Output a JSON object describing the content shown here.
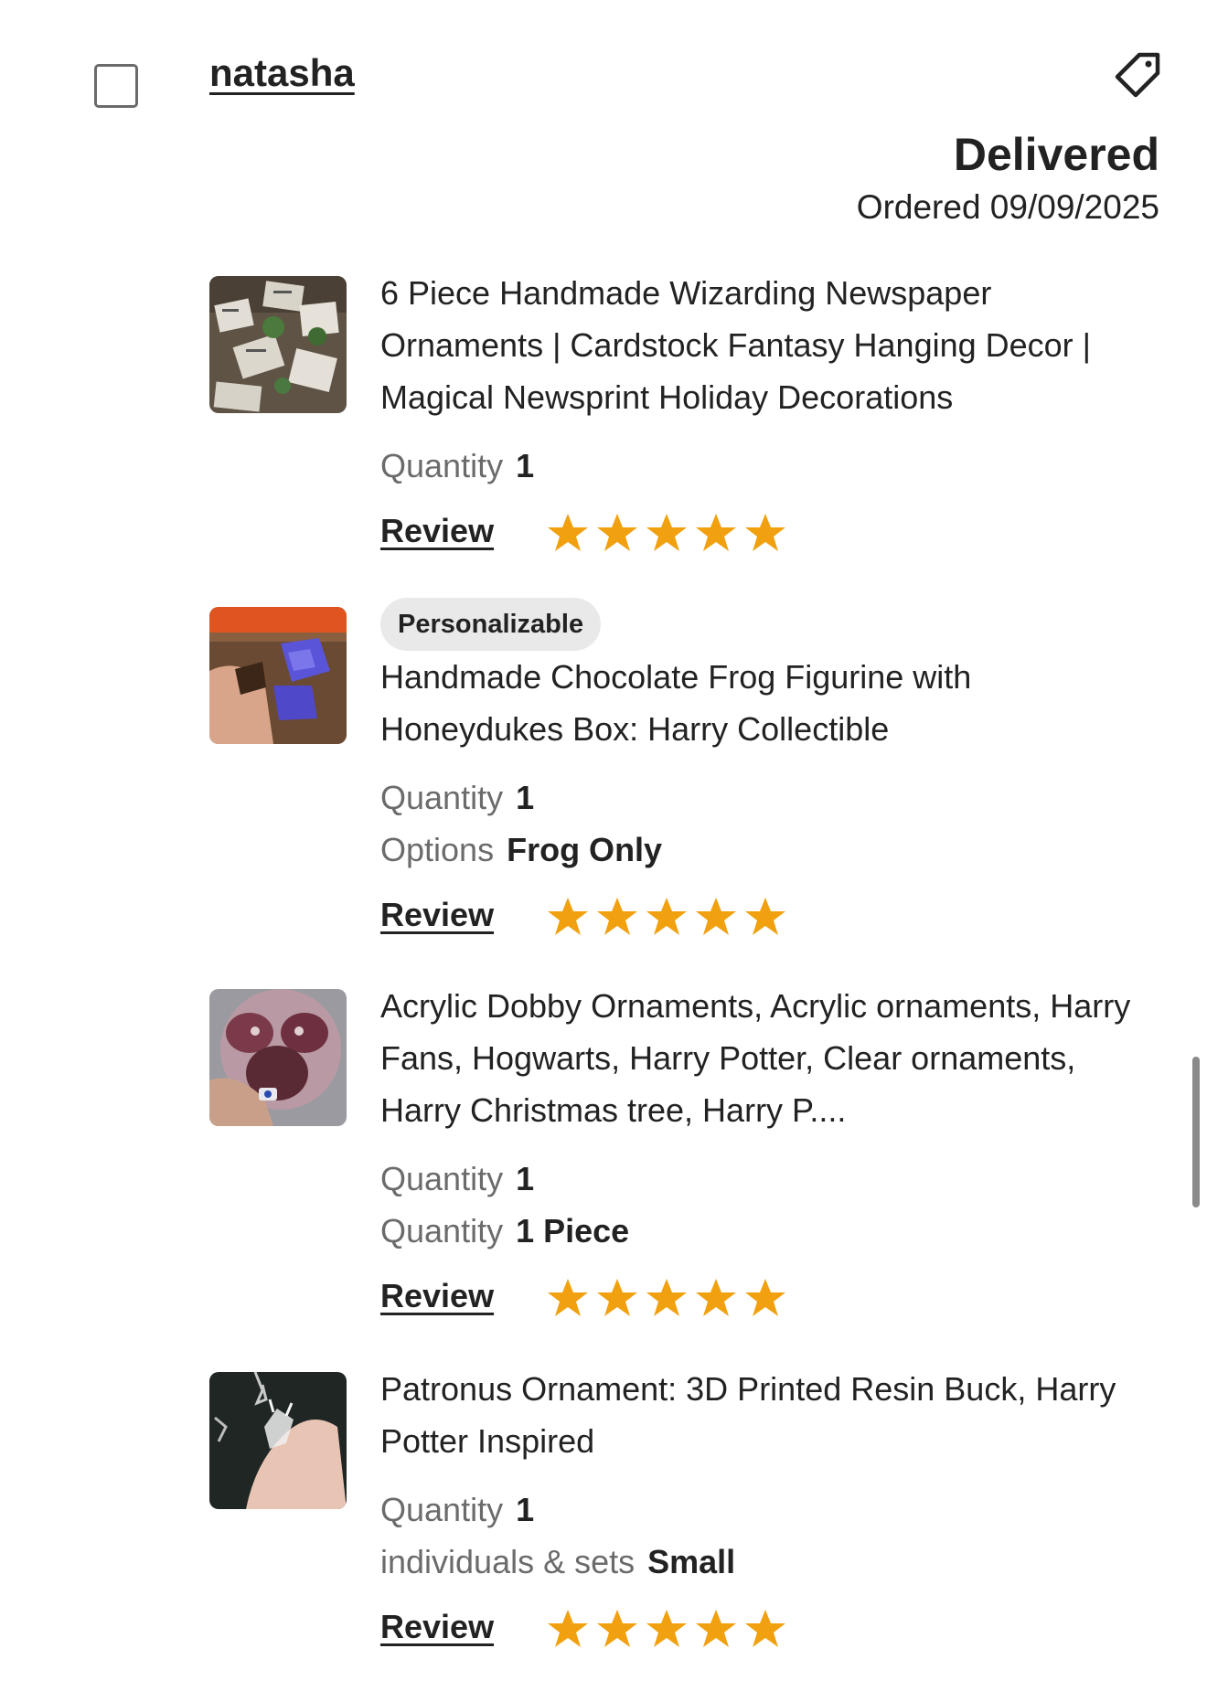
{
  "order": {
    "buyer_name": "natasha",
    "status": "Delivered",
    "ordered_label": "Ordered 09/09/2025"
  },
  "colors": {
    "star": "#F1A10F",
    "text": "#222222",
    "muted": "#6b6b6b",
    "badge_bg": "#e9e9e9"
  },
  "icons": {
    "tag": "tag-icon",
    "checkbox": "checkbox",
    "star": "star-icon"
  },
  "items": [
    {
      "title": "6 Piece Handmade Wizarding Newspaper Ornaments | Cardstock Fantasy Hanging Decor | Magical Newsprint Holiday Decorations",
      "badge": "",
      "attributes": [
        {
          "label": "Quantity",
          "value": "1"
        }
      ],
      "review_label": "Review",
      "rating": 5
    },
    {
      "title": "Handmade Chocolate Frog Figurine with Honeydukes Box: Harry Collectible",
      "badge": "Personalizable",
      "attributes": [
        {
          "label": "Quantity",
          "value": "1"
        },
        {
          "label": "Options",
          "value": "Frog Only"
        }
      ],
      "review_label": "Review",
      "rating": 5
    },
    {
      "title": "Acrylic Dobby Ornaments, Acrylic ornaments, Harry Fans, Hogwarts, Harry Potter, Clear ornaments, Harry Christmas tree, Harry P....",
      "badge": "",
      "attributes": [
        {
          "label": "Quantity",
          "value": "1"
        },
        {
          "label": "Quantity",
          "value": "1 Piece"
        }
      ],
      "review_label": "Review",
      "rating": 5
    },
    {
      "title": "Patronus Ornament: 3D Printed Resin Buck, Harry Potter Inspired",
      "badge": "",
      "attributes": [
        {
          "label": "Quantity",
          "value": "1"
        },
        {
          "label": "individuals & sets",
          "value": "Small"
        }
      ],
      "review_label": "Review",
      "rating": 5
    }
  ]
}
